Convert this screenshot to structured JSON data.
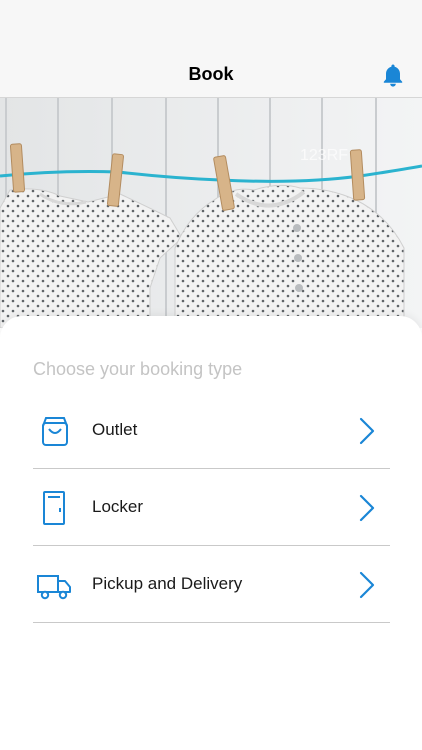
{
  "header": {
    "title": "Book",
    "notification_icon": "bell-icon"
  },
  "hero": {
    "watermark": "123RF"
  },
  "booking": {
    "heading": "Choose your booking type",
    "options": [
      {
        "label": "Outlet",
        "icon": "shopping-bag-icon"
      },
      {
        "label": "Locker",
        "icon": "locker-icon"
      },
      {
        "label": "Pickup and Delivery",
        "icon": "delivery-truck-icon"
      }
    ]
  },
  "colors": {
    "accent": "#1a86d6",
    "nav_background": "#f7f7f7",
    "divider": "#c9c9c9",
    "heading_gray": "#c4c4c4"
  }
}
